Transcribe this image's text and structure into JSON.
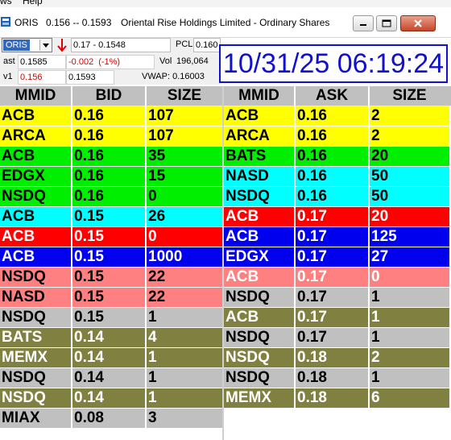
{
  "menu": {
    "items": [
      "ws",
      "Help"
    ]
  },
  "titlebar": {
    "symbol": "ORIS",
    "range": "0.156 -- 0.1593",
    "name": "Oriental Rise Holdings Limited - Ordinary Shares"
  },
  "level1": {
    "symbol_value": "ORIS",
    "range_value": "0.17 - 0.1548",
    "pcl_label": "PCL",
    "pcl_value": "0.160",
    "last_label": "ast",
    "last_value": "0.1585",
    "change_value": "-0.002",
    "change_pct": "(-1%)",
    "vol_label": "Vol",
    "vol_value": "196,064",
    "v1_label": "v1",
    "v1_value": "0.156",
    "v2_value": "0.1593",
    "vwap": "VWAP: 0.16003"
  },
  "clock": "10/31/25 06:19:24",
  "colors": {
    "yellow": "#ffff00",
    "green": "#00ee00",
    "cyan": "#00ffff",
    "red": "#ff0000",
    "blue": "#0000ee",
    "salmon": "#ff8080",
    "gray": "#c0c0c0",
    "olive": "#808040"
  },
  "bid_book": {
    "headers": [
      "MMID",
      "BID",
      "SIZE"
    ],
    "rows": [
      {
        "mmid": "ACB",
        "price": "0.16",
        "size": "107",
        "bg": "yellow",
        "fg": "#000000"
      },
      {
        "mmid": "ARCA",
        "price": "0.16",
        "size": "107",
        "bg": "yellow",
        "fg": "#000000"
      },
      {
        "mmid": "ACB",
        "price": "0.16",
        "size": "35",
        "bg": "green",
        "fg": "#000000"
      },
      {
        "mmid": "EDGX",
        "price": "0.16",
        "size": "15",
        "bg": "green",
        "fg": "#000000"
      },
      {
        "mmid": "NSDQ",
        "price": "0.16",
        "size": "0",
        "bg": "green",
        "fg": "#000000"
      },
      {
        "mmid": "ACB",
        "price": "0.15",
        "size": "26",
        "bg": "cyan",
        "fg": "#000000"
      },
      {
        "mmid": "ACB",
        "price": "0.15",
        "size": "0",
        "bg": "red",
        "fg": "#ffffff"
      },
      {
        "mmid": "ACB",
        "price": "0.15",
        "size": "1000",
        "bg": "blue",
        "fg": "#ffffff"
      },
      {
        "mmid": "NSDQ",
        "price": "0.15",
        "size": "22",
        "bg": "salmon",
        "fg": "#000000"
      },
      {
        "mmid": "NASD",
        "price": "0.15",
        "size": "22",
        "bg": "salmon",
        "fg": "#000000"
      },
      {
        "mmid": "NSDQ",
        "price": "0.15",
        "size": "1",
        "bg": "gray",
        "fg": "#000000"
      },
      {
        "mmid": "BATS",
        "price": "0.14",
        "size": "4",
        "bg": "olive",
        "fg": "#ffffff"
      },
      {
        "mmid": "MEMX",
        "price": "0.14",
        "size": "1",
        "bg": "olive",
        "fg": "#ffffff"
      },
      {
        "mmid": "NSDQ",
        "price": "0.14",
        "size": "1",
        "bg": "gray",
        "fg": "#000000"
      },
      {
        "mmid": "NSDQ",
        "price": "0.14",
        "size": "1",
        "bg": "olive",
        "fg": "#ffffff"
      },
      {
        "mmid": "MIAX",
        "price": "0.08",
        "size": "3",
        "bg": "gray",
        "fg": "#000000"
      }
    ]
  },
  "ask_book": {
    "headers": [
      "MMID",
      "ASK",
      "SIZE"
    ],
    "rows": [
      {
        "mmid": "ACB",
        "price": "0.16",
        "size": "2",
        "bg": "yellow",
        "fg": "#000000"
      },
      {
        "mmid": "ARCA",
        "price": "0.16",
        "size": "2",
        "bg": "yellow",
        "fg": "#000000"
      },
      {
        "mmid": "BATS",
        "price": "0.16",
        "size": "20",
        "bg": "green",
        "fg": "#000000"
      },
      {
        "mmid": "NASD",
        "price": "0.16",
        "size": "50",
        "bg": "cyan",
        "fg": "#000000"
      },
      {
        "mmid": "NSDQ",
        "price": "0.16",
        "size": "50",
        "bg": "cyan",
        "fg": "#000000"
      },
      {
        "mmid": "ACB",
        "price": "0.17",
        "size": "20",
        "bg": "red",
        "fg": "#ffffff"
      },
      {
        "mmid": "ACB",
        "price": "0.17",
        "size": "125",
        "bg": "blue",
        "fg": "#ffffff"
      },
      {
        "mmid": "EDGX",
        "price": "0.17",
        "size": "27",
        "bg": "blue",
        "fg": "#ffffff"
      },
      {
        "mmid": "ACB",
        "price": "0.17",
        "size": "0",
        "bg": "salmon",
        "fg": "#ffffff"
      },
      {
        "mmid": "NSDQ",
        "price": "0.17",
        "size": "1",
        "bg": "gray",
        "fg": "#000000"
      },
      {
        "mmid": "ACB",
        "price": "0.17",
        "size": "1",
        "bg": "olive",
        "fg": "#ffffff"
      },
      {
        "mmid": "NSDQ",
        "price": "0.17",
        "size": "1",
        "bg": "gray",
        "fg": "#000000"
      },
      {
        "mmid": "NSDQ",
        "price": "0.18",
        "size": "2",
        "bg": "olive",
        "fg": "#ffffff"
      },
      {
        "mmid": "NSDQ",
        "price": "0.18",
        "size": "1",
        "bg": "gray",
        "fg": "#000000"
      },
      {
        "mmid": "MEMX",
        "price": "0.18",
        "size": "6",
        "bg": "olive",
        "fg": "#ffffff"
      }
    ]
  }
}
